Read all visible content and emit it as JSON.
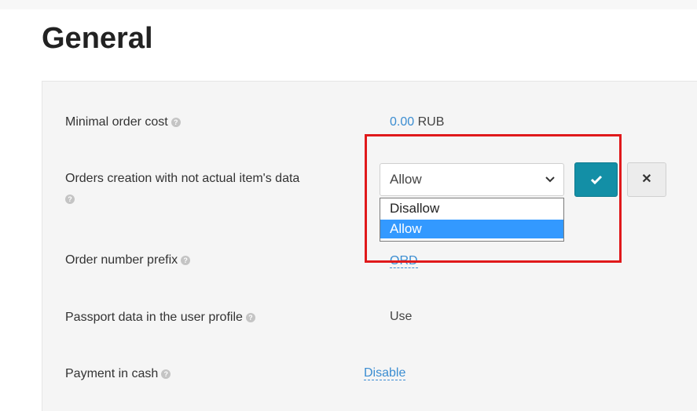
{
  "page": {
    "title": "General"
  },
  "settings": {
    "min_order_cost": {
      "label": "Minimal order cost",
      "amount": "0.00",
      "currency": "RUB"
    },
    "orders_creation": {
      "label": "Orders creation with not actual item's data",
      "selected": "Allow",
      "options": [
        "Disallow",
        "Allow"
      ],
      "confirm_icon": "check-icon",
      "cancel_icon": "close-icon"
    },
    "order_prefix": {
      "label": "Order number prefix",
      "value": "ORD"
    },
    "passport_data": {
      "label": "Passport data in the user profile",
      "value": "Use"
    },
    "payment_cash": {
      "label": "Payment in cash",
      "value": "Disable"
    }
  },
  "icons": {
    "help": "question-icon"
  },
  "colors": {
    "accent": "#138fa6",
    "link": "#3b8dd1",
    "highlight": "#e0191b",
    "option_selected": "#3399ff"
  }
}
